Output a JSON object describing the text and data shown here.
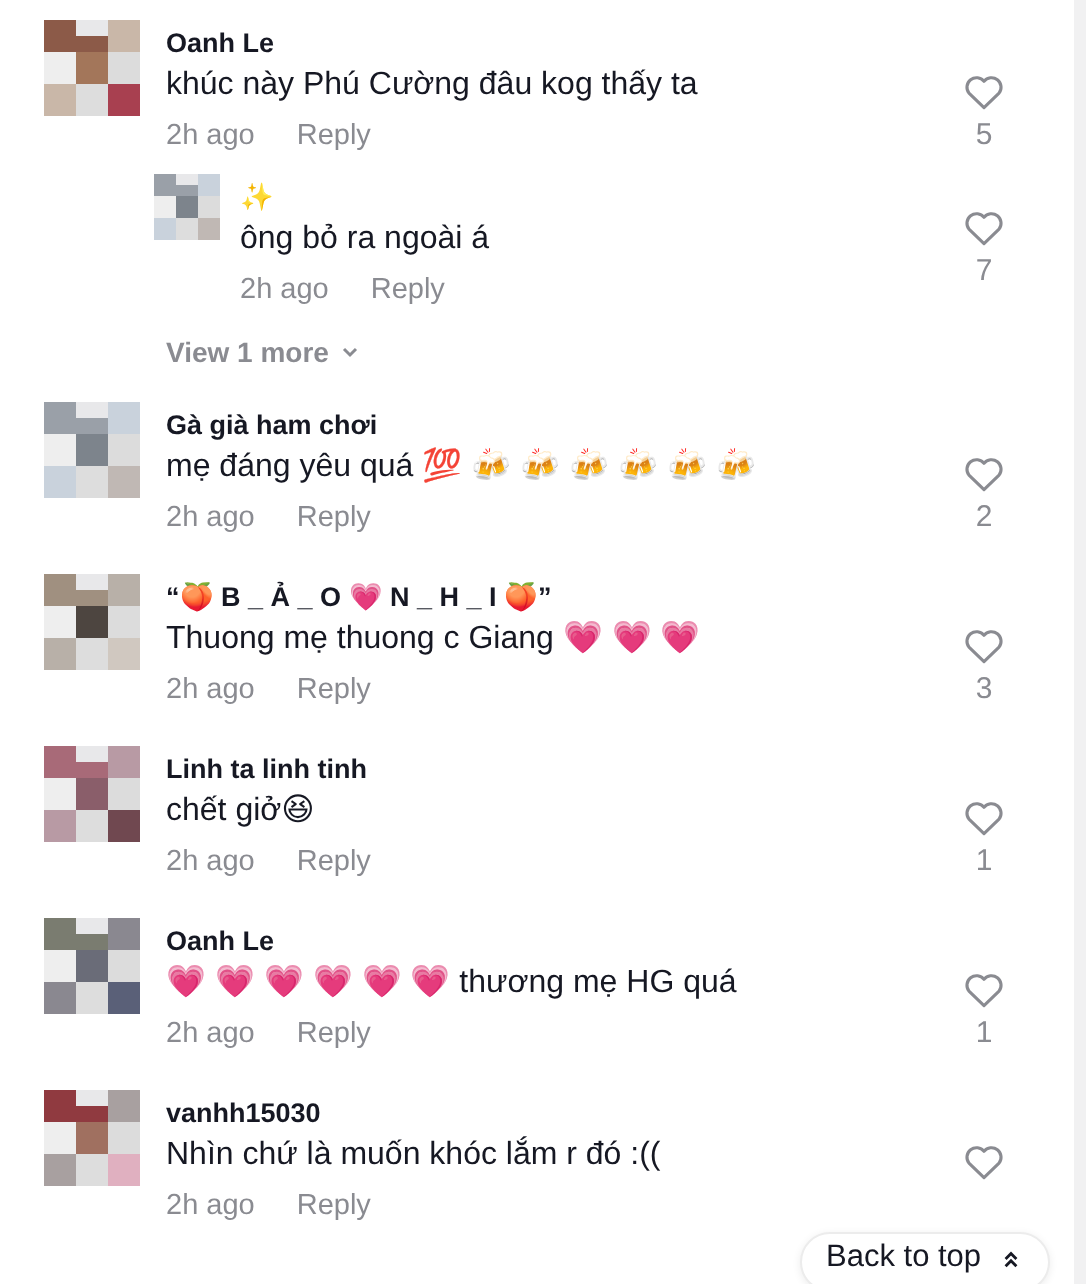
{
  "comments": [
    {
      "author": "Oanh Le",
      "text": "khúc này Phú Cường đâu kog thấy ta",
      "time": "2h ago",
      "reply_label": "Reply",
      "likes": "5",
      "replies": [
        {
          "author": "✨",
          "text": "ông bỏ ra ngoài á",
          "time": "2h ago",
          "reply_label": "Reply",
          "likes": "7"
        }
      ],
      "view_more": "View 1 more"
    },
    {
      "author": "Gà già ham chơi",
      "text": "mẹ đáng yêu quá 💯 🍻 🍻 🍻 🍻 🍻 🍻",
      "time": "2h ago",
      "reply_label": "Reply",
      "likes": "2"
    },
    {
      "author": "“🍑 B _ Ả _ O 💗 N _ H _ I 🍑”",
      "text": "Thuong mẹ thuong c Giang 💗 💗 💗",
      "time": "2h ago",
      "reply_label": "Reply",
      "likes": "3"
    },
    {
      "author": "Linh ta linh tinh",
      "text": "chết giở😆",
      "time": "2h ago",
      "reply_label": "Reply",
      "likes": "1"
    },
    {
      "author": "Oanh Le",
      "text": "💗 💗 💗 💗 💗 💗 thương mẹ HG quá",
      "time": "2h ago",
      "reply_label": "Reply",
      "likes": "1"
    },
    {
      "author": "vanhh15030",
      "text": "Nhìn chứ là muốn khóc lắm r đó :((",
      "time": "2h ago",
      "reply_label": "Reply"
    }
  ],
  "back_to_top": "Back to top"
}
